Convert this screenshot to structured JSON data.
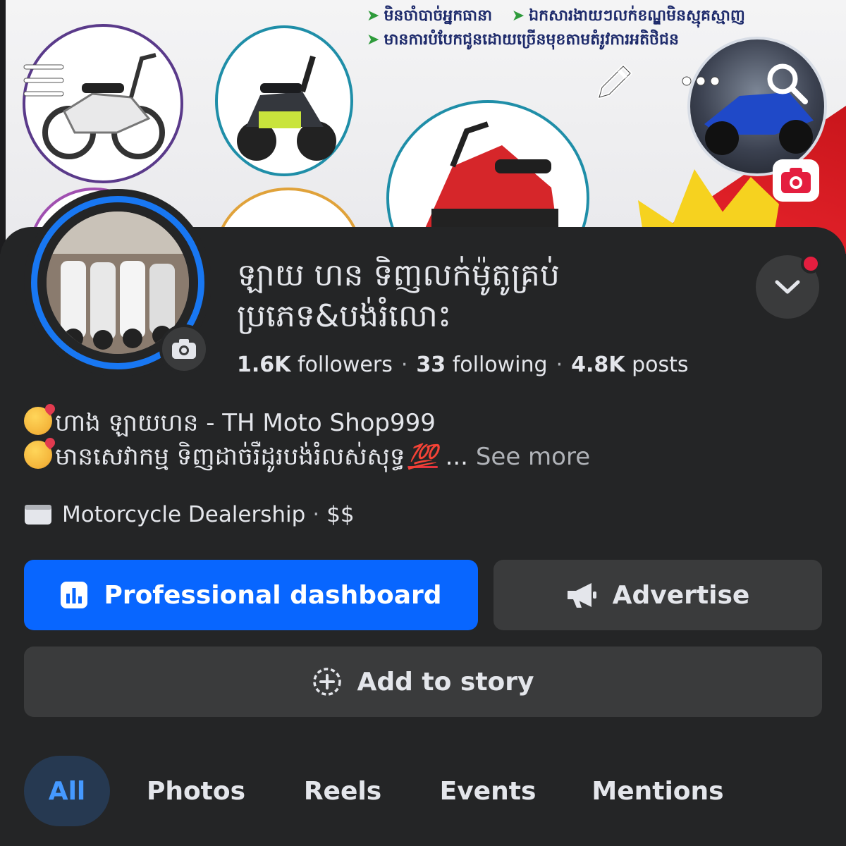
{
  "cover": {
    "bullets": [
      "មិនចាំបាច់អ្នកធានា",
      "ឯកសារងាយៗលក់ខណ្ឌមិនស្មុគស្មាញ",
      "មានការបំបែកជូនដោយច្រើនមុខតាមតំរូវការអតិថិជន"
    ]
  },
  "toolbar": {
    "menu_icon": "hamburger-menu-icon",
    "edit_icon": "pencil-icon",
    "more_icon": "more-dots-icon",
    "search_icon": "search-icon",
    "cover_camera_icon": "camera-icon"
  },
  "profile": {
    "name": "ឡាយ ហន ទិញលក់ម៉ូតូគ្រប់ប្រភេទ&បង់រំលោះ",
    "followers_count": "1.6K",
    "followers_label": "followers",
    "following_count": "33",
    "following_label": "following",
    "posts_count": "4.8K",
    "posts_label": "posts",
    "separator": "·"
  },
  "bio": {
    "line1": "ហាង ឡាយហន - TH Moto Shop999",
    "line2": "មានសេវាកម្ម ទិញដាច់រឺដូរបង់រំលស់សុទ្ធ",
    "hundred": "💯",
    "ellipsis": "...",
    "see_more": "See more"
  },
  "category": {
    "name": "Motorcycle Dealership",
    "separator": "·",
    "price": "$$"
  },
  "buttons": {
    "dashboard": "Professional dashboard",
    "advertise": "Advertise",
    "add_story": "Add to story"
  },
  "tabs": [
    "All",
    "Photos",
    "Reels",
    "Events",
    "Mentions"
  ],
  "colors": {
    "background": "#242526",
    "primary": "#0866ff",
    "secondary_button": "#3a3b3c",
    "active_tab_bg": "#263951",
    "active_tab_text": "#4599ff",
    "notification_dot": "#e41e3f"
  }
}
